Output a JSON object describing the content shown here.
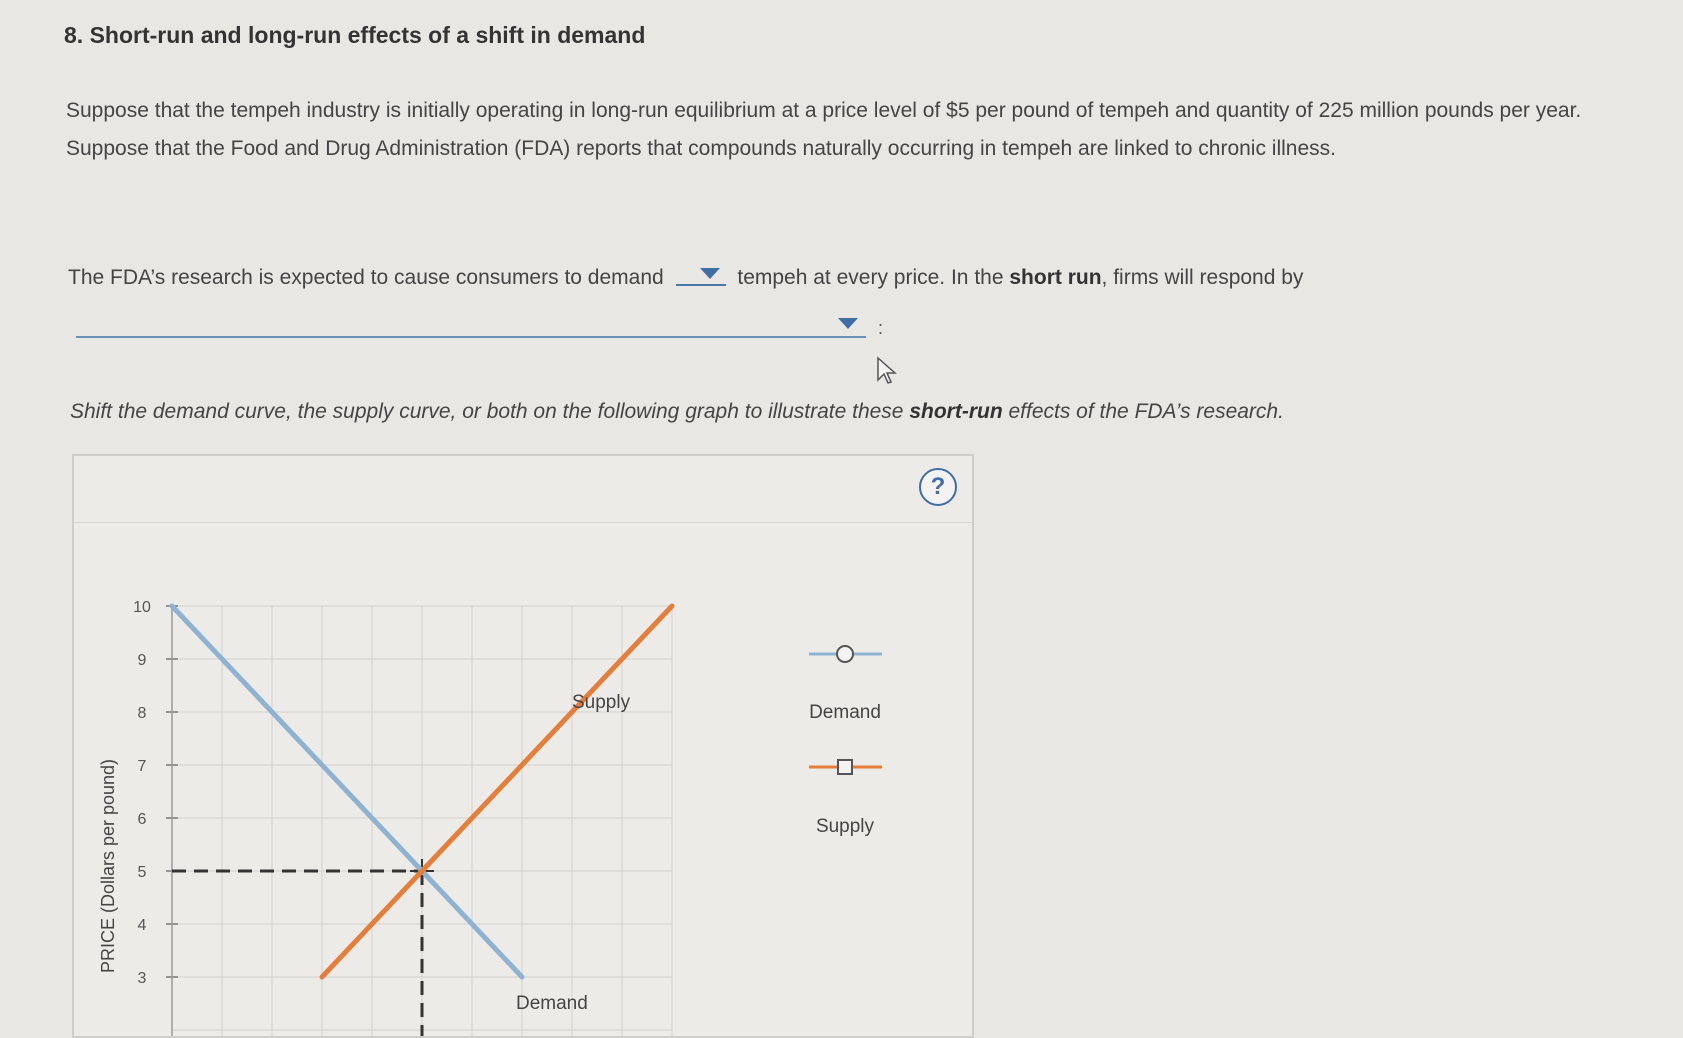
{
  "question": {
    "title": "8. Short-run and long-run effects of a shift in demand",
    "paragraph": "Suppose that the tempeh industry is initially operating in long-run equilibrium at a price level of $5 per pound of tempeh and quantity of 225 million pounds per year. Suppose that the Food and Drug Administration (FDA) reports that compounds naturally occurring in tempeh are linked to chronic illness.",
    "sentence_part1": "The FDA’s research is expected to cause consumers to demand",
    "sentence_part2": "tempeh at every price. In the ",
    "sentence_bold": "short run",
    "sentence_part3": ", firms will respond by",
    "colon": ":",
    "instruction_part1": "Shift the demand curve, the supply curve, or both on the following graph to illustrate these ",
    "instruction_bold": "short-run",
    "instruction_part2": " effects of the FDA’s research."
  },
  "dropdowns": {
    "demand_change": {
      "selected": ""
    },
    "firm_response": {
      "selected": ""
    }
  },
  "icons": {
    "help": "?",
    "cursor": "cursor-arrow-icon"
  },
  "colors": {
    "demand": "#8fb2d1",
    "supply": "#e67e3a",
    "accent": "#3f6ea5",
    "dashed": "#333333"
  },
  "graph": {
    "ylabel": "PRICE (Dollars per pound)",
    "curve_labels": {
      "supply": "Supply",
      "demand": "Demand"
    },
    "legend": [
      {
        "label": "Demand",
        "marker": "circle"
      },
      {
        "label": "Supply",
        "marker": "square"
      }
    ]
  },
  "chart_data": {
    "type": "line",
    "xlabel": "",
    "ylabel": "PRICE (Dollars per pound)",
    "ylim": [
      0,
      10
    ],
    "yticks": [
      3,
      4,
      5,
      6,
      7,
      8,
      9,
      10
    ],
    "grid": true,
    "series": [
      {
        "name": "Demand",
        "points": [
          [
            0,
            10
          ],
          [
            225,
            5
          ],
          [
            315,
            3
          ]
        ]
      },
      {
        "name": "Supply",
        "points": [
          [
            135,
            3
          ],
          [
            225,
            5
          ],
          [
            450,
            10
          ]
        ]
      }
    ],
    "equilibrium": {
      "price": 5,
      "quantity": 225
    }
  }
}
